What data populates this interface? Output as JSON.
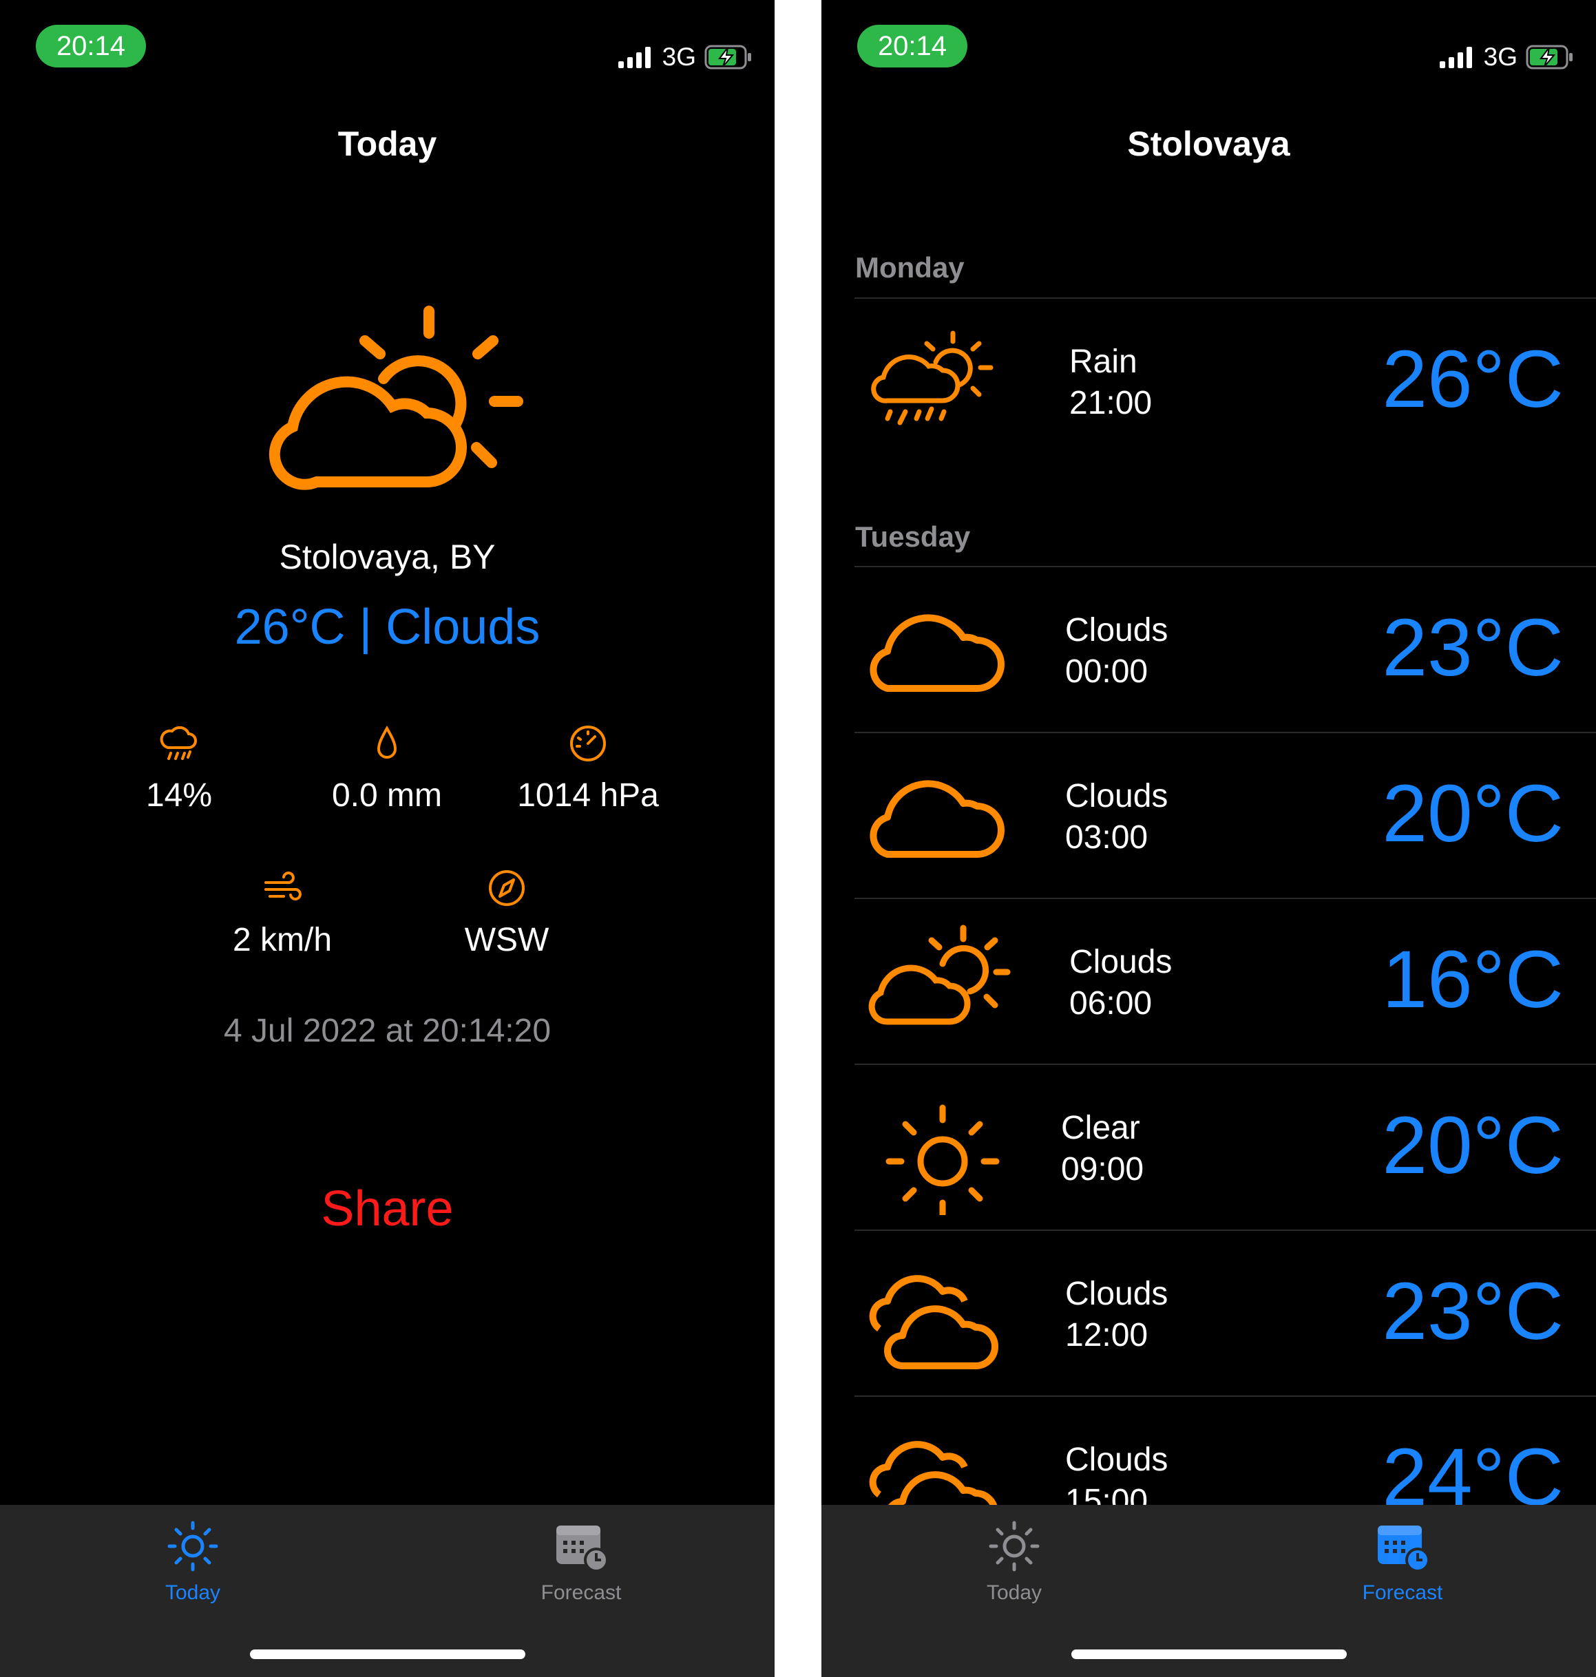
{
  "status_bar": {
    "time": "20:14",
    "network": "3G"
  },
  "today_screen": {
    "title": "Today",
    "location": "Stolovaya, BY",
    "summary": "26°C | Clouds",
    "metrics": {
      "precip_chance": "14%",
      "precip_amount": "0.0 mm",
      "pressure": "1014 hPa",
      "wind_speed": "2 km/h",
      "wind_direction": "WSW"
    },
    "updated": "4 Jul 2022 at 20:14:20",
    "share_label": "Share"
  },
  "forecast_screen": {
    "title": "Stolovaya",
    "sections": [
      {
        "day": "Monday",
        "rows": [
          {
            "icon": "rain-sun-icon",
            "condition": "Rain",
            "time": "21:00",
            "temp": "26°C"
          }
        ]
      },
      {
        "day": "Tuesday",
        "rows": [
          {
            "icon": "cloud-icon",
            "condition": "Clouds",
            "time": "00:00",
            "temp": "23°C"
          },
          {
            "icon": "cloud-icon",
            "condition": "Clouds",
            "time": "03:00",
            "temp": "20°C"
          },
          {
            "icon": "cloud-sun-icon",
            "condition": "Clouds",
            "time": "06:00",
            "temp": "16°C"
          },
          {
            "icon": "sun-icon",
            "condition": "Clear",
            "time": "09:00",
            "temp": "20°C"
          },
          {
            "icon": "clouds-icon",
            "condition": "Clouds",
            "time": "12:00",
            "temp": "23°C"
          },
          {
            "icon": "clouds-icon",
            "condition": "Clouds",
            "time": "15:00",
            "temp": "24°C"
          }
        ]
      }
    ]
  },
  "tabs": [
    {
      "label": "Today"
    },
    {
      "label": "Forecast"
    }
  ],
  "colors": {
    "accent": "#1a84ff",
    "icon_orange": "#ff8a00",
    "share_red": "#ff1a1a",
    "tab_inactive": "#8e8e93"
  }
}
